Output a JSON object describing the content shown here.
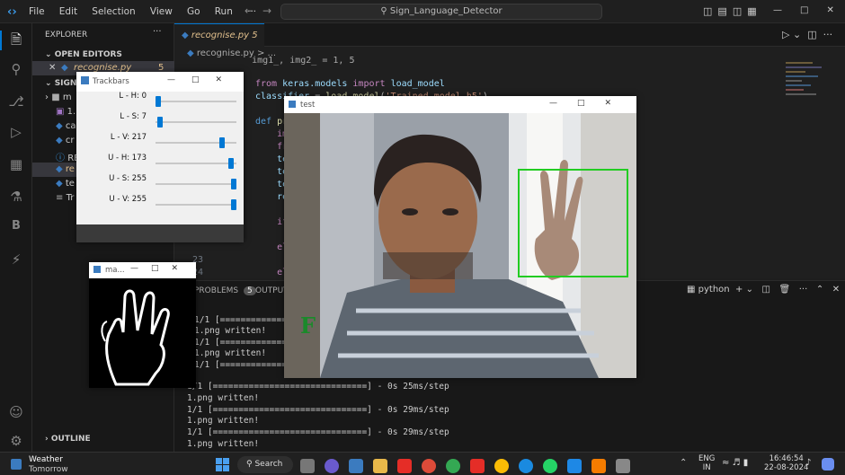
{
  "vscode": {
    "menu": [
      "File",
      "Edit",
      "Selection",
      "View",
      "Go",
      "Run",
      "···"
    ],
    "search_text": "Sign_Language_Detector",
    "explorer_header": "EXPLORER",
    "open_editors": "OPEN EDITORS",
    "open_file": "recognise.py",
    "open_file_badge": "5",
    "folder": "SIGN_LA",
    "files": [
      "m",
      "1.",
      "ca",
      "cr",
      "RE",
      "re",
      "te",
      "Tr"
    ],
    "outline": "OUTLINE",
    "tab_label": "recognise.py",
    "tab_badge": "5",
    "breadcrumb": "recognise.py > ...",
    "code_lines": [
      "    img1_, img2_ = 1, 5",
      "from keras.models import load_model",
      "classifier = load_model('Trained_model.h5')",
      "def predictor():",
      "    import",
      "    from k",
      "    test_i",
      "    test_i",
      "    test_i",
      "    result",
      "",
      "    if res",
      "",
      "    elif r",
      "",
      "    elif r"
    ],
    "line_numbers": [
      "23",
      "24"
    ],
    "panel_tab_problems": "PROBLEMS",
    "panel_problems_badge": "5",
    "panel_tab_output": "OUTPUT",
    "terminal_kind": "python",
    "terminal_lines": [
      "1/1 [==============",
      "1.png written!",
      "1/1 [==============",
      "1.png written!",
      "1/1 [==============",
      "1/1 [==============================] - 0s 25ms/step",
      "1.png written!",
      "1/1 [==============================] - 0s 29ms/step",
      "1.png written!",
      "1/1 [==============================] - 0s 29ms/step",
      "1.png written!"
    ],
    "terminal_partial": [
      "1.png written!"
    ]
  },
  "trackbars": {
    "title": "Trackbars",
    "bars": [
      {
        "label": "L - H: 0",
        "value": 0,
        "max": 179
      },
      {
        "label": "L - S: 7",
        "value": 7,
        "max": 255
      },
      {
        "label": "L - V: 217",
        "value": 217,
        "max": 255
      },
      {
        "label": "U - H: 173",
        "value": 173,
        "max": 179
      },
      {
        "label": "U - S: 255",
        "value": 255,
        "max": 255
      },
      {
        "label": "U - V: 255",
        "value": 255,
        "max": 255
      }
    ]
  },
  "mask_window": {
    "title": "ma..."
  },
  "test_window": {
    "title": "test",
    "prediction": "F",
    "box_color": "#22cc22"
  },
  "taskbar": {
    "weather_title": "Weather",
    "weather_sub": "Tomorrow",
    "search": "Search",
    "lang_top": "ENG",
    "lang_bottom": "IN",
    "time": "16:46:54",
    "date": "22-08-2024"
  },
  "colors": {
    "accent": "#0078d4",
    "modified": "#e2c08d"
  }
}
